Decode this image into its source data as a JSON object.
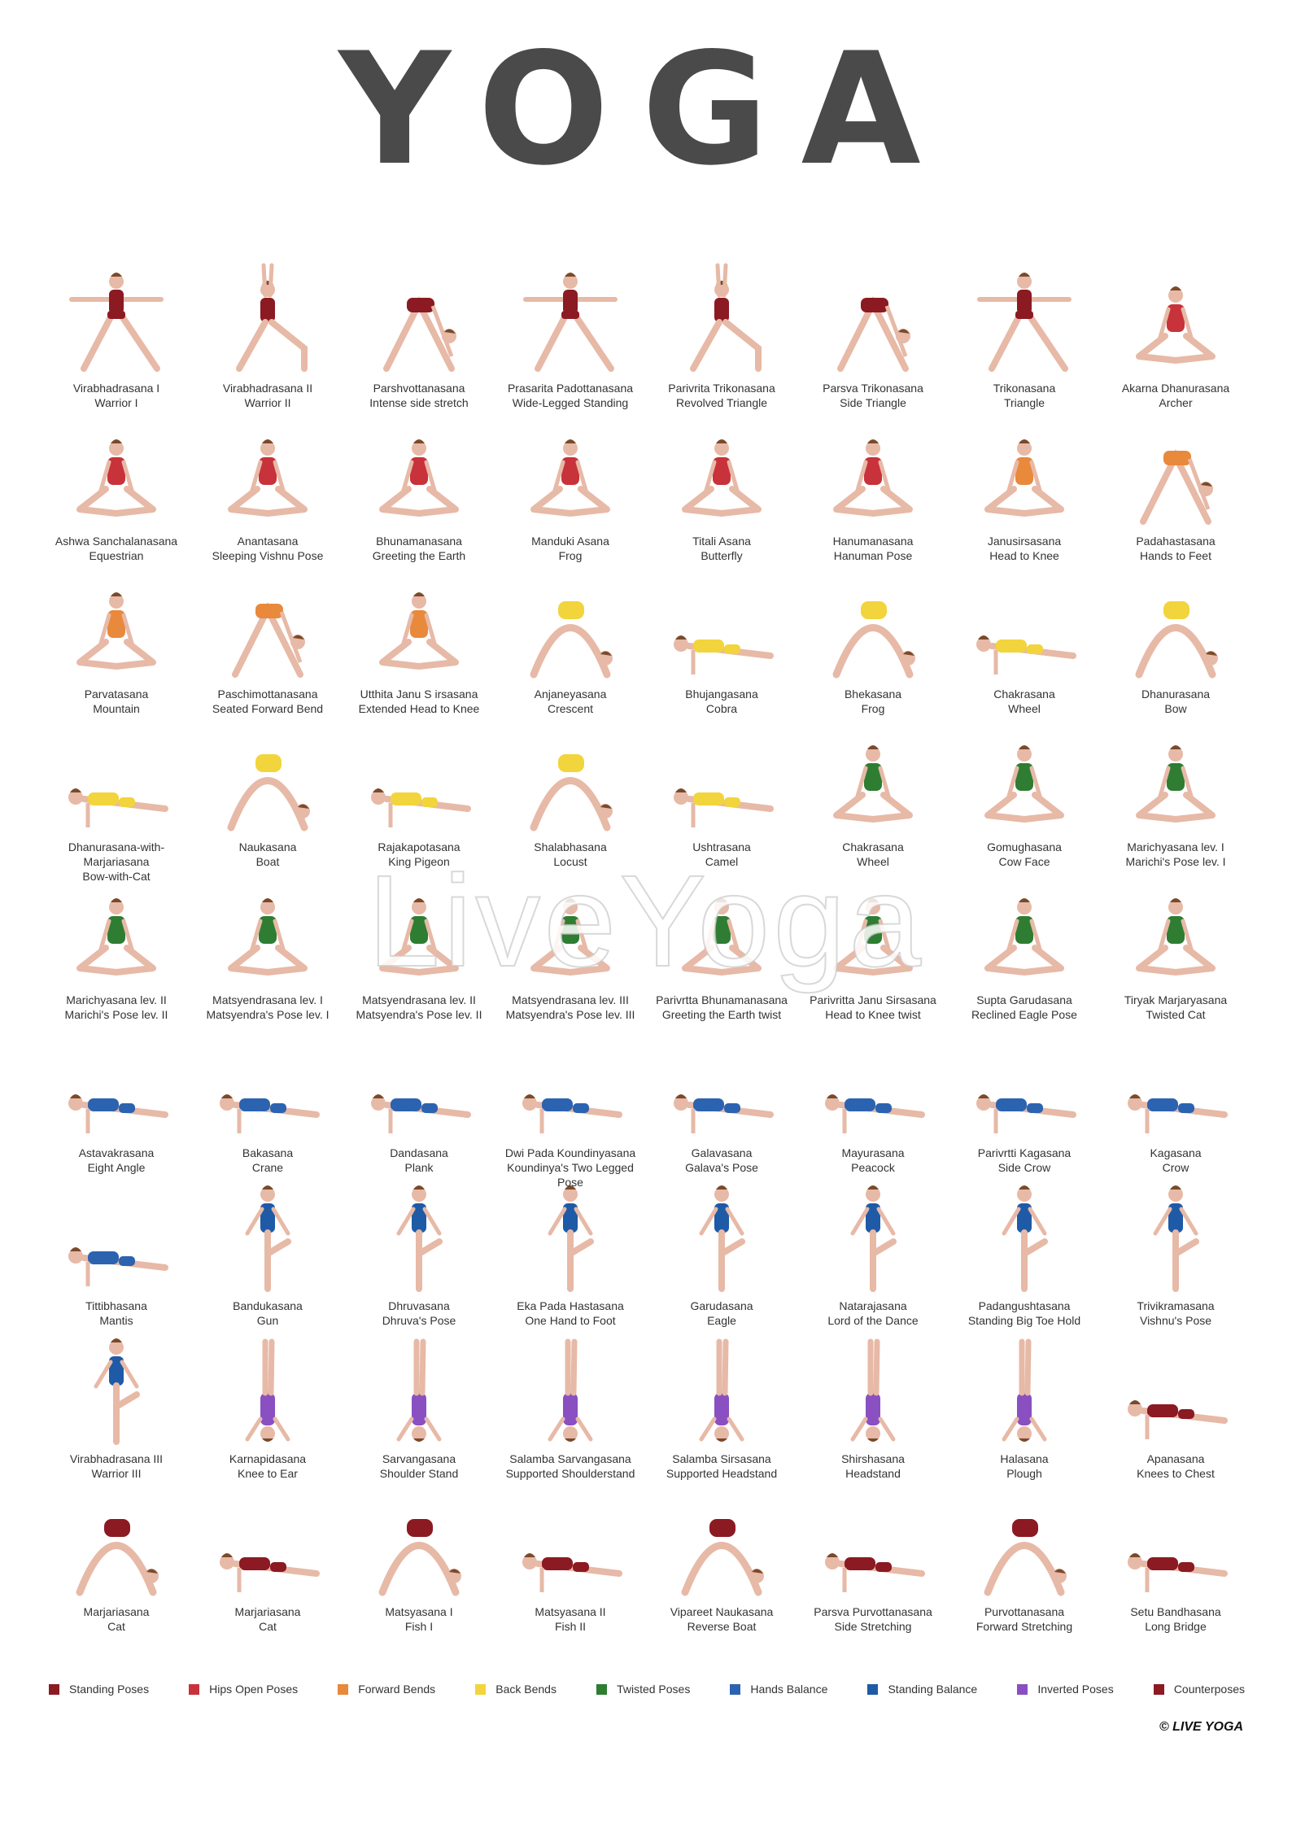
{
  "title": "YOGA",
  "watermark": "LiveYoga",
  "brand": "© LIVE YOGA",
  "colors": {
    "standing": "#8b1a22",
    "hips": "#c8323a",
    "forward": "#e8893c",
    "back": "#f2d43c",
    "twisted": "#2e7d32",
    "hands": "#2c63b0",
    "balance": "#1f5aa6",
    "inverted": "#8a4fc1",
    "counter": "#8b1a22",
    "skin": "#e7b9a7",
    "hair": "#7a4a2a"
  },
  "poses": [
    {
      "name": "Virabhadrasana I",
      "sub": "Warrior I",
      "cat": "standing"
    },
    {
      "name": "Virabhadrasana II",
      "sub": "Warrior II",
      "cat": "standing"
    },
    {
      "name": "Parshvottanasana",
      "sub": "Intense side stretch",
      "cat": "standing"
    },
    {
      "name": "Prasarita Padottanasana",
      "sub": "Wide-Legged Standing",
      "cat": "standing"
    },
    {
      "name": "Parivrita Trikonasana",
      "sub": "Revolved Triangle",
      "cat": "standing"
    },
    {
      "name": "Parsva Trikonasana",
      "sub": "Side Triangle",
      "cat": "standing"
    },
    {
      "name": "Trikonasana",
      "sub": "Triangle",
      "cat": "standing"
    },
    {
      "name": "Akarna Dhanurasana",
      "sub": "Archer",
      "cat": "hips"
    },
    {
      "name": "Ashwa Sanchalanasana",
      "sub": "Equestrian",
      "cat": "hips"
    },
    {
      "name": "Anantasana",
      "sub": "Sleeping Vishnu Pose",
      "cat": "hips"
    },
    {
      "name": "Bhunamanasana",
      "sub": "Greeting the Earth",
      "cat": "hips"
    },
    {
      "name": "Manduki Asana",
      "sub": "Frog",
      "cat": "hips"
    },
    {
      "name": "Titali Asana",
      "sub": "Butterfly",
      "cat": "hips"
    },
    {
      "name": "Hanumanasana",
      "sub": "Hanuman Pose",
      "cat": "hips"
    },
    {
      "name": "Janusirsasana",
      "sub": "Head to Knee",
      "cat": "forward"
    },
    {
      "name": "Padahastasana",
      "sub": "Hands to Feet",
      "cat": "forward"
    },
    {
      "name": "Parvatasana",
      "sub": "Mountain",
      "cat": "forward"
    },
    {
      "name": "Paschimottanasana",
      "sub": "Seated Forward Bend",
      "cat": "forward"
    },
    {
      "name": "Utthita Janu S irsasana",
      "sub": "Extended Head to Knee",
      "cat": "forward"
    },
    {
      "name": "Anjaneyasana",
      "sub": "Crescent",
      "cat": "back"
    },
    {
      "name": "Bhujangasana",
      "sub": "Cobra",
      "cat": "back"
    },
    {
      "name": "Bhekasana",
      "sub": "Frog",
      "cat": "back"
    },
    {
      "name": "Chakrasana",
      "sub": "Wheel",
      "cat": "back"
    },
    {
      "name": "Dhanurasana",
      "sub": "Bow",
      "cat": "back"
    },
    {
      "name": "Dhanurasana-with-Marjariasana",
      "sub": "Bow-with-Cat",
      "cat": "back"
    },
    {
      "name": "Naukasana",
      "sub": "Boat",
      "cat": "back"
    },
    {
      "name": "Rajakapotasana",
      "sub": "King Pigeon",
      "cat": "back"
    },
    {
      "name": "Shalabhasana",
      "sub": "Locust",
      "cat": "back"
    },
    {
      "name": "Ushtrasana",
      "sub": "Camel",
      "cat": "back"
    },
    {
      "name": "Chakrasana",
      "sub": "Wheel",
      "cat": "twisted"
    },
    {
      "name": "Gomughasana",
      "sub": "Cow Face",
      "cat": "twisted"
    },
    {
      "name": "Marichyasana lev. I",
      "sub": "Marichi's Pose lev. I",
      "cat": "twisted"
    },
    {
      "name": "Marichyasana lev. II",
      "sub": "Marichi's Pose lev. II",
      "cat": "twisted"
    },
    {
      "name": "Matsyendrasana lev. I",
      "sub": "Matsyendra's Pose lev. I",
      "cat": "twisted"
    },
    {
      "name": "Matsyendrasana lev. II",
      "sub": "Matsyendra's Pose lev. II",
      "cat": "twisted"
    },
    {
      "name": "Matsyendrasana lev. III",
      "sub": "Matsyendra's Pose lev. III",
      "cat": "twisted"
    },
    {
      "name": "Parivrtta Bhunamanasana",
      "sub": "Greeting the Earth twist",
      "cat": "twisted"
    },
    {
      "name": "Parivritta Janu Sirsasana",
      "sub": "Head to Knee twist",
      "cat": "twisted"
    },
    {
      "name": "Supta Garudasana",
      "sub": "Reclined Eagle Pose",
      "cat": "twisted"
    },
    {
      "name": "Tiryak Marjaryasana",
      "sub": "Twisted Cat",
      "cat": "twisted"
    },
    {
      "name": "Astavakrasana",
      "sub": "Eight Angle",
      "cat": "hands"
    },
    {
      "name": "Bakasana",
      "sub": "Crane",
      "cat": "hands"
    },
    {
      "name": "Dandasana",
      "sub": "Plank",
      "cat": "hands"
    },
    {
      "name": "Dwi Pada Koundinyasana",
      "sub": "Koundinya's Two Legged Pose",
      "cat": "hands"
    },
    {
      "name": "Galavasana",
      "sub": "Galava's Pose",
      "cat": "hands"
    },
    {
      "name": "Mayurasana",
      "sub": "Peacock",
      "cat": "hands"
    },
    {
      "name": "Parivrtti Kagasana",
      "sub": "Side Crow",
      "cat": "hands"
    },
    {
      "name": "Kagasana",
      "sub": "Crow",
      "cat": "hands"
    },
    {
      "name": "Tittibhasana",
      "sub": "Mantis",
      "cat": "hands"
    },
    {
      "name": "Bandukasana",
      "sub": "Gun",
      "cat": "balance"
    },
    {
      "name": "Dhruvasana",
      "sub": "Dhruva's Pose",
      "cat": "balance"
    },
    {
      "name": "Eka Pada Hastasana",
      "sub": "One Hand to Foot",
      "cat": "balance"
    },
    {
      "name": "Garudasana",
      "sub": "Eagle",
      "cat": "balance"
    },
    {
      "name": "Natarajasana",
      "sub": "Lord of the Dance",
      "cat": "balance"
    },
    {
      "name": "Padangushtasana",
      "sub": "Standing Big Toe Hold",
      "cat": "balance"
    },
    {
      "name": "Trivikramasana",
      "sub": "Vishnu's Pose",
      "cat": "balance"
    },
    {
      "name": "Virabhadrasana III",
      "sub": "Warrior III",
      "cat": "balance"
    },
    {
      "name": "Karnapidasana",
      "sub": "Knee to Ear",
      "cat": "inverted"
    },
    {
      "name": "Sarvangasana",
      "sub": "Shoulder Stand",
      "cat": "inverted"
    },
    {
      "name": "Salamba Sarvangasana",
      "sub": "Supported Shoulderstand",
      "cat": "inverted"
    },
    {
      "name": "Salamba Sirsasana",
      "sub": "Supported Headstand",
      "cat": "inverted"
    },
    {
      "name": "Shirshasana",
      "sub": "Headstand",
      "cat": "inverted"
    },
    {
      "name": "Halasana",
      "sub": "Plough",
      "cat": "inverted"
    },
    {
      "name": "Apanasana",
      "sub": "Knees to Chest",
      "cat": "counter"
    },
    {
      "name": "Marjariasana",
      "sub": "Cat",
      "cat": "counter"
    },
    {
      "name": "Marjariasana",
      "sub": "Cat",
      "cat": "counter"
    },
    {
      "name": "Matsyasana I",
      "sub": "Fish I",
      "cat": "counter"
    },
    {
      "name": "Matsyasana II",
      "sub": "Fish II",
      "cat": "counter"
    },
    {
      "name": "Vipareet Naukasana",
      "sub": "Reverse Boat",
      "cat": "counter"
    },
    {
      "name": "Parsva Purvottanasana",
      "sub": "Side Stretching",
      "cat": "counter"
    },
    {
      "name": "Purvottanasana",
      "sub": "Forward Stretching",
      "cat": "counter"
    },
    {
      "name": "Setu Bandhasana",
      "sub": "Long Bridge",
      "cat": "counter"
    }
  ],
  "legend": [
    {
      "label": "Standing Poses",
      "cat": "standing"
    },
    {
      "label": "Hips Open Poses",
      "cat": "hips"
    },
    {
      "label": "Forward Bends",
      "cat": "forward"
    },
    {
      "label": "Back Bends",
      "cat": "back"
    },
    {
      "label": "Twisted Poses",
      "cat": "twisted"
    },
    {
      "label": "Hands Balance",
      "cat": "hands"
    },
    {
      "label": "Standing Balance",
      "cat": "balance"
    },
    {
      "label": "Inverted Poses",
      "cat": "inverted"
    },
    {
      "label": "Counterposes",
      "cat": "counter"
    }
  ]
}
